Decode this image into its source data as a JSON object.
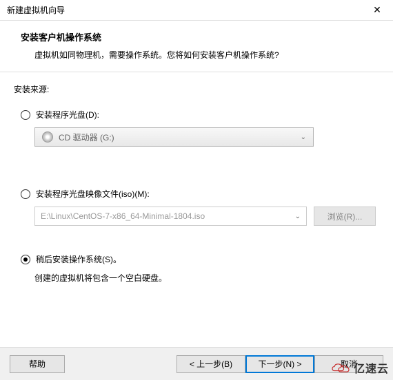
{
  "titlebar": {
    "title": "新建虚拟机向导"
  },
  "header": {
    "title": "安装客户机操作系统",
    "description": "虚拟机如同物理机，需要操作系统。您将如何安装客户机操作系统?"
  },
  "content": {
    "source_label": "安装来源:",
    "option1": {
      "label": "安装程序光盘(D):",
      "dropdown_text": "CD 驱动器 (G:)"
    },
    "option2": {
      "label": "安装程序光盘映像文件(iso)(M):",
      "input_value": "E:\\Linux\\CentOS-7-x86_64-Minimal-1804.iso",
      "browse_label": "浏览(R)..."
    },
    "option3": {
      "label": "稍后安装操作系统(S)。",
      "hint": "创建的虚拟机将包含一个空白硬盘。"
    }
  },
  "footer": {
    "help": "帮助",
    "back": "< 上一步(B)",
    "next": "下一步(N) >",
    "cancel": "取消"
  },
  "watermark": {
    "text": "亿速云"
  }
}
